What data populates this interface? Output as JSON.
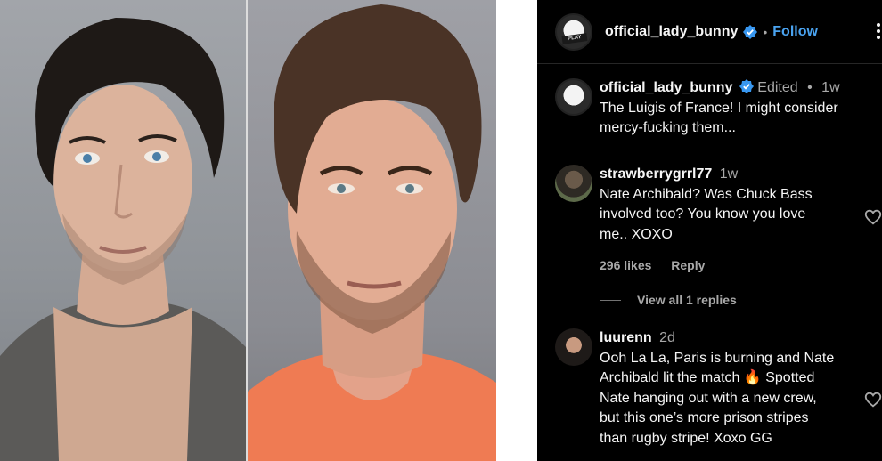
{
  "post": {
    "username": "official_lady_bunny",
    "follow_label": "Follow",
    "dot": "•"
  },
  "caption": {
    "username": "official_lady_bunny",
    "edited": "Edited",
    "dot": "•",
    "time": "1w",
    "text_line1": "The Luigis of France! I might consider",
    "text_line2": "mercy-fucking them..."
  },
  "comments": [
    {
      "username": "strawberrygrrl77",
      "time": "1w",
      "text_line1": "Nate Archibald? Was Chuck Bass",
      "text_line2": "involved too? You know you love",
      "text_line3": "me.. XOXO",
      "likes": "296 likes",
      "reply_label": "Reply"
    },
    {
      "username": "luurenn",
      "time": "2d",
      "text_line1": "Ooh La La, Paris is burning and Nate",
      "text_line2": "Archibald lit the match 🔥 Spotted",
      "text_line3": "Nate hanging out with a new crew,",
      "text_line4": "but this one’s more prison stripes",
      "text_line5": "than rugby stripe! Xoxo GG"
    }
  ],
  "view_replies_label": "View all 1 replies",
  "colors": {
    "accent": "#4aa3f0",
    "verified": "#3897f0",
    "muted": "#a8a8a8"
  },
  "icons": [
    "verified-badge-icon",
    "more-options-icon",
    "heart-icon"
  ]
}
